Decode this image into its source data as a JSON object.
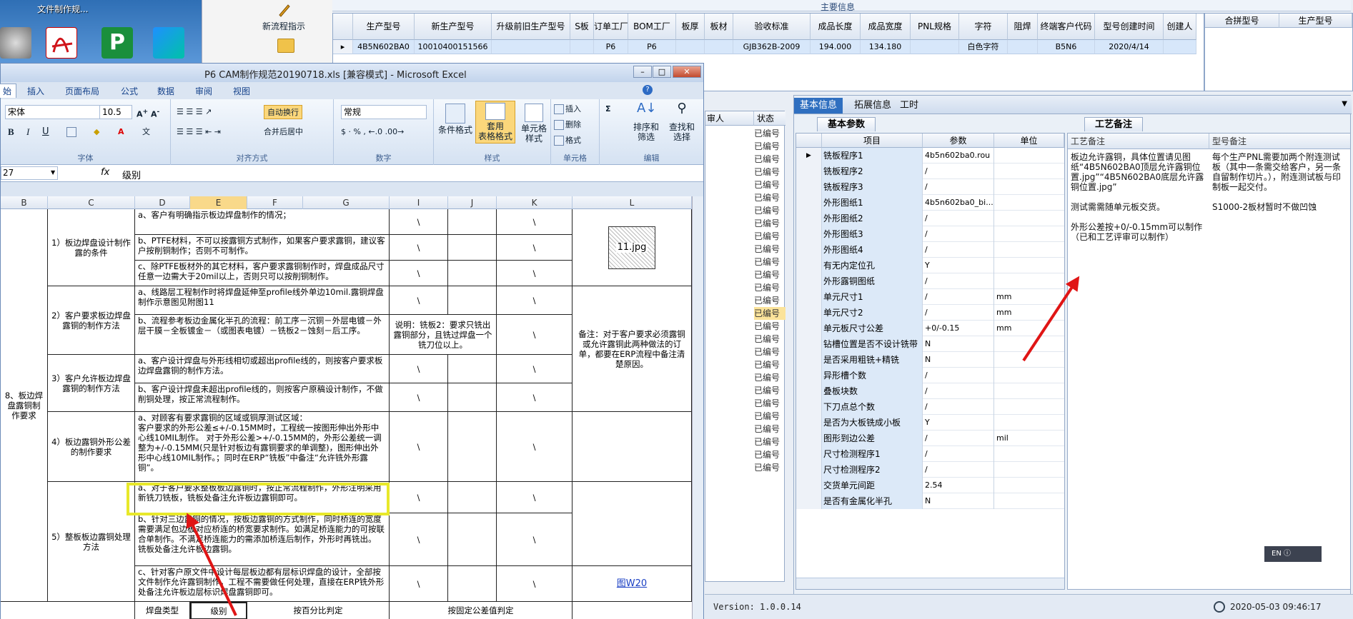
{
  "desktop": {
    "caption": "文件制作规...",
    "task_label": "新流程指示"
  },
  "main_grid": {
    "title": "主要信息",
    "headers": [
      "生产型号",
      "新生产型号",
      "升级前旧生产型号",
      "S板",
      "订单工厂",
      "BOM工厂",
      "板厚",
      "板材",
      "验收标准",
      "成品长度",
      "成品宽度",
      "PNL规格",
      "字符",
      "阻焊",
      "终端客户代码",
      "型号创建时间",
      "创建人"
    ],
    "row": [
      "4B5N602BA0",
      "10010400151566",
      "",
      "",
      "P6",
      "P6",
      "",
      "",
      "GJB362B-2009",
      "194.000",
      "134.180",
      "",
      "白色字符",
      "",
      "B5N6",
      "2020/4/14",
      ""
    ],
    "side_headers": [
      "合拼型号",
      "生产型号"
    ]
  },
  "status_col": {
    "headers": [
      "审人",
      "状态"
    ],
    "value": "已编号",
    "count": 27
  },
  "detail": {
    "tabs": [
      "基本信息",
      "拓展信息",
      "工时"
    ],
    "subtab_params": "基本参数",
    "subtab_remarks": "工艺备注",
    "param_headers": [
      "项目",
      "参数",
      "单位"
    ],
    "params": [
      {
        "item": "铣板程序1",
        "value": "4b5n602ba0.rou",
        "unit": ""
      },
      {
        "item": "铣板程序2",
        "value": "/",
        "unit": ""
      },
      {
        "item": "铣板程序3",
        "value": "/",
        "unit": ""
      },
      {
        "item": "外形图纸1",
        "value": "4b5n602ba0_bi...",
        "unit": ""
      },
      {
        "item": "外形图纸2",
        "value": "/",
        "unit": ""
      },
      {
        "item": "外形图纸3",
        "value": "/",
        "unit": ""
      },
      {
        "item": "外形图纸4",
        "value": "/",
        "unit": ""
      },
      {
        "item": "有无内定位孔",
        "value": "Y",
        "unit": ""
      },
      {
        "item": "外形露铜图纸",
        "value": "/",
        "unit": ""
      },
      {
        "item": "单元尺寸1",
        "value": "/",
        "unit": "mm"
      },
      {
        "item": "单元尺寸2",
        "value": "/",
        "unit": "mm"
      },
      {
        "item": "单元板尺寸公差",
        "value": "+0/-0.15",
        "unit": "mm"
      },
      {
        "item": "钻槽位置是否不设计铣带",
        "value": "N",
        "unit": ""
      },
      {
        "item": "是否采用粗铣+精铣",
        "value": "N",
        "unit": ""
      },
      {
        "item": "异形槽个数",
        "value": "/",
        "unit": ""
      },
      {
        "item": "叠板块数",
        "value": "/",
        "unit": ""
      },
      {
        "item": "下刀点总个数",
        "value": "/",
        "unit": ""
      },
      {
        "item": "是否为大板铣成小板",
        "value": "Y",
        "unit": ""
      },
      {
        "item": "图形到边公差",
        "value": "/",
        "unit": "mil"
      },
      {
        "item": "尺寸检测程序1",
        "value": "/",
        "unit": ""
      },
      {
        "item": "尺寸检测程序2",
        "value": "/",
        "unit": ""
      },
      {
        "item": "交货单元间距",
        "value": "2.54",
        "unit": ""
      },
      {
        "item": "是否有金属化半孔",
        "value": "N",
        "unit": ""
      }
    ],
    "remark_headers": [
      "工艺备注",
      "型号备注"
    ],
    "process_remark": "板边允许露铜，具体位置请见图纸“4B5N602BA0顶层允许露铜位置.jpg”“4B5N602BA0底层允许露铜位置.jpg”\n\n测试需需随单元板交货。\n\n外形公差按+0/-0.15mm可以制作（已和工艺评审可以制作）",
    "model_remark": "每个生产PNL需要加两个附连测试板（其中一条需交给客户，另一条自留制作切片。），附连测试板与印制板一起交付。\n\nS1000-2板材暂时不做凹蚀",
    "version": "Version: 1.0.0.14",
    "datetime": "2020-05-03  09:46:17"
  },
  "excel": {
    "title": "P6 CAM制作规范20190718.xls  [兼容模式] - Microsoft Excel",
    "ribbon_tabs": [
      "始",
      "插入",
      "页面布局",
      "公式",
      "数据",
      "审阅",
      "视图"
    ],
    "font_name": "宋体",
    "font_size": "10.5",
    "number_format": "常规",
    "wrap_text": "自动换行",
    "merge_center": "合并后居中",
    "group_labels": {
      "font": "字体",
      "align": "对齐方式",
      "number": "数字",
      "style": "样式",
      "cells": "单元格",
      "edit": "编辑"
    },
    "buttons": {
      "cond_format": "条件格式",
      "table_format": "套用\n表格格式",
      "cell_style": "单元格\n样式",
      "insert": "插入",
      "delete": "删除",
      "format": "格式",
      "sort_filter": "排序和\n筛选",
      "find_select": "查找和\n选择"
    },
    "name_box": "27",
    "formula_value": "级别",
    "columns": [
      "B",
      "C",
      "D",
      "E",
      "F",
      "G",
      "I",
      "J",
      "K",
      "L"
    ],
    "section_label": "8、板边焊盘露铜制作要求",
    "groups": [
      {
        "title": "1）板边焊盘设计制作露的条件",
        "rows": [
          "a、客户有明确指示板边焊盘制作的情况；",
          "b、PTFE材料，不可以按露铜方式制作，如果客户要求露铜，建议客户按削铜制作；否则不可制作。",
          "c、除PTFE板材外的其它材料，客户要求露铜制作时，焊盘成品尺寸任意一边需大于20mil以上，否则只可以按削铜制作。"
        ]
      },
      {
        "title": "2）客户要求板边焊盘露铜的制作方法",
        "rows": [
          "a、线路层工程制作时将焊盘延伸至profile线外单边10mil.露铜焊盘制作示意图见附图11",
          "b、流程参考板边金属化半孔的流程：前工序－沉铜－外层电镀－外层干膜－全板镀金－（或图表电镀）－铣板2－蚀刻－后工序。"
        ]
      },
      {
        "title": "3）客户允许板边焊盘露铜的制作方法",
        "rows": [
          "a、客户设计焊盘与外形线相切或超出profile线的，则按客户要求板边焊盘露铜的制作方法。",
          "b、客户设计焊盘未超出profile线的，则按客户原稿设计制作，不做削铜处理，按正常流程制作。"
        ]
      },
      {
        "title": "4）板边露铜外形公差的制作要求",
        "rows": [
          "a、对顾客有要求露铜的区域或铜厚测试区域：\n客户要求的外形公差≤+/-0.15MM时，工程统一按图形伸出外形中心线10MIL制作。 对于外形公差>+/-0.15MM的，外形公差统一调整为+/-0.15MM(只是针对板边有露铜要求的单调整)，图形伸出外形中心线10MIL制作。；同时在ERP“铣板”中备注“允许铣外形露铜”。"
        ]
      },
      {
        "title": "5）整板板边露铜处理方法",
        "rows": [
          "a、对于客户要求整板板边露铜时，按正常流程制作，外形注明采用新铣刀铣板，铣板处备注允许板边露铜即可。",
          "b、针对三边露铜的情况，按板边露铜的方式制作，同时桥连的宽度需要满足包边板对应桥连的桥宽要求制作。如满足桥连能力的可按联合单制作。不满足桥连能力的需添加桥连后制作，外形时再铣出。 铣板处备注允许板边露铜。",
          "c、针对客户原文件中设计每层板边都有层标识焊盘的设计，全部按文件制作允许露铜制作，工程不需要做任何处理，直接在ERP铣外形处备注允许板边层标识焊盘露铜即可。"
        ]
      }
    ],
    "note_i": "说明：铣板2：要求只铣出露铜部分，且铣过焊盘一个铣刀位以上。",
    "note_l": "备注：对于客户要求必须露铜或允许露铜此两种做法的订单，都要在ERP流程中备注清楚原因。",
    "image_label": "11.jpg",
    "link_label": "图W20",
    "footer_cells": [
      "焊盘类型",
      "级别",
      "按百分比判定",
      "按固定公差值判定"
    ],
    "backslash": "\\"
  },
  "colors": {
    "accent": "#2f6fc0",
    "highlight": "#e8e82a",
    "arrow": "#e01515",
    "row_select": "#d7e7fa"
  }
}
